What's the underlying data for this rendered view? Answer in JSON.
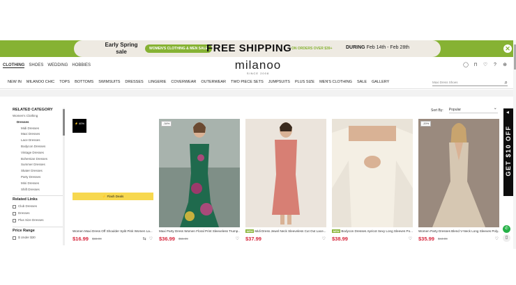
{
  "banner": {
    "spring": "Early Spring sale",
    "pill": "WOMEN'S CLOTHING & MEN SALE",
    "free_shipping": "FREE SHIPPING",
    "order_sub": "ON ORDERS OVER $39+",
    "during_label": "DURING",
    "during_dates": "Feb 14th - Feb 28th",
    "close": "✕"
  },
  "header": {
    "top_cats": [
      "CLOTHING",
      "SHOES",
      "WEDDING",
      "HOBBIES"
    ],
    "logo": "milanoo",
    "logo_since": "SINCE 2008"
  },
  "nav": {
    "items": [
      "NEW IN",
      "MILANOO CHIC",
      "TOPS",
      "BOTTOMS",
      "SWIMSUITS",
      "DRESSES",
      "LINGERIE",
      "COVERWEAR",
      "OUTERWEAR",
      "TWO PIECE SETS",
      "JUMPSUITS",
      "PLUS SIZE",
      "MEN'S CLOTHING",
      "SALE",
      "GALLERY"
    ],
    "search_placeholder": "Maxi Dress Shoes"
  },
  "sidebar": {
    "related_heading": "RELATED CATEGORY",
    "parent": "Women's Clothing",
    "current": "Dresses",
    "subitems": [
      "Midi Dresses",
      "Maxi Dresses",
      "Lace Dresses",
      "Bodycon Dresses",
      "Vintage Dresses",
      "Bohemian Dresses",
      "Summer Dresses",
      "Skater Dresses",
      "Party Dresses",
      "Mini Dresses",
      "Shift Dresses"
    ],
    "links_heading": "Related Links",
    "links": [
      "Club Dresses",
      "Dresses",
      "Plus Size Dresses"
    ],
    "price_heading": "Price Range",
    "price_first": "$ Under $30"
  },
  "sort": {
    "label": "Sort By:",
    "value": "Popular"
  },
  "products": [
    {
      "badge": "",
      "new_tag": "",
      "title": "Women Maxi Dress Off Shoulder Split Pink Women La...",
      "price": "$16.99",
      "old": "$33.99",
      "flash": "⚡ Flash Deals",
      "black_tag": "⚡ 40%"
    },
    {
      "badge": "-34%",
      "new_tag": "",
      "title": "Maxi Party Dress Women Floral Print Sleeveless Trump...",
      "price": "$36.99",
      "old": "$55.99",
      "flash": "",
      "black_tag": ""
    },
    {
      "badge": "",
      "new_tag": "NEW",
      "title": "Midi Dress Jewel Neck Sleeveless Cut Out Lace...",
      "price": "$37.99",
      "old": "",
      "flash": "",
      "black_tag": ""
    },
    {
      "badge": "",
      "new_tag": "NEW",
      "title": "Bodycon Dresses Apricot Sexy Long Sleeves Po...",
      "price": "$38.99",
      "old": "",
      "flash": "",
      "black_tag": ""
    },
    {
      "badge": "-20%",
      "new_tag": "",
      "title": "Women Party Dresses Blend V-Neck Long Sleeves Poly...",
      "price": "$35.99",
      "old": "$44.99",
      "flash": "",
      "black_tag": ""
    }
  ],
  "widgets": {
    "get10": "GET $10 OFF"
  }
}
